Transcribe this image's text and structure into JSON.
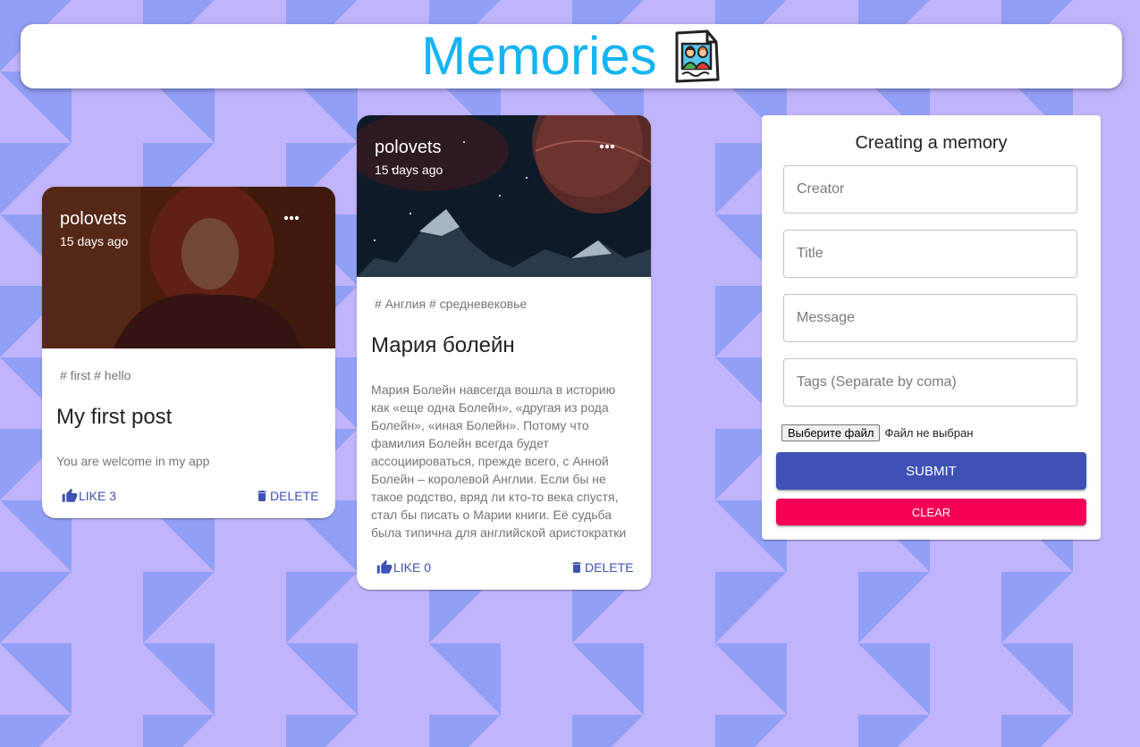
{
  "header": {
    "title": "Memories",
    "logo_icon": "memories-photo-icon",
    "title_color": "#16b4f2"
  },
  "posts": [
    {
      "creator": "polovets",
      "time": "15 days ago",
      "tags": "# first # hello",
      "title": "My first post",
      "message": "You are welcome in my app",
      "like_label": "LIKE 3",
      "delete_label": "DELETE",
      "image_icon": "girl-portrait-photo"
    },
    {
      "creator": "polovets",
      "time": "15 days ago",
      "tags": "# Англия # средневековье",
      "title": "Мария болейн",
      "message": "Мария Болейн навсегда вошла в историю как «еще одна Болейн», «другая из рода Болейн», «иная Болейн». Потому что фамилия Болейн всегда будет ассоциироваться, прежде всего, с Анной Болейн – королевой Англии. Если бы не такое родство, вряд ли кто-то века спустя, стал бы писать о Марии книги. Её судьба была типична для английской аристократки",
      "like_label": "LIKE 0",
      "delete_label": "DELETE",
      "image_icon": "space-planet-photo"
    }
  ],
  "form": {
    "heading": "Creating a memory",
    "creator_placeholder": "Creator",
    "title_placeholder": "Title",
    "message_placeholder": "Message",
    "tags_placeholder": "Tags (Separate by coma)",
    "file_button": "Выберите файл",
    "file_status": "Файл не выбран",
    "submit_label": "SUBMIT",
    "clear_label": "CLEAR"
  },
  "colors": {
    "primary": "#3f51b5",
    "secondary": "#f50057",
    "background_light": "#c0b4fc",
    "background_dark": "#929ff6"
  }
}
